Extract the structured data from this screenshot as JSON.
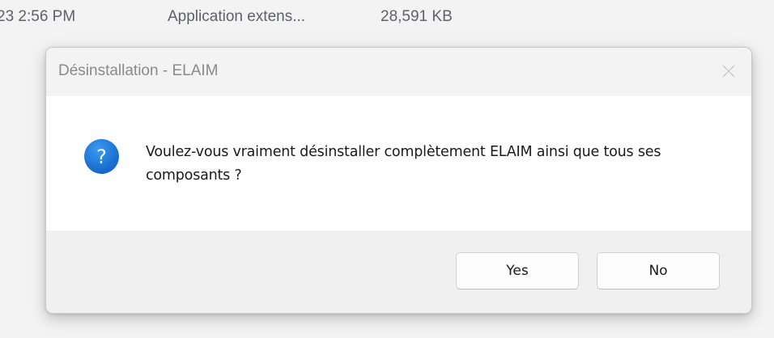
{
  "background_row": {
    "date": "23 2:56 PM",
    "type": "Application extens...",
    "size": "28,591 KB"
  },
  "dialog": {
    "title": "Désinstallation - ELAIM",
    "message": "Voulez-vous vraiment désinstaller complètement ELAIM ainsi que tous ses composants ?",
    "icon": "question-icon",
    "buttons": {
      "yes": "Yes",
      "no": "No"
    },
    "close_icon": "close-icon"
  },
  "colors": {
    "icon_blue": "#1b73d3",
    "titlebar": "#f3f3f3",
    "footer": "#f0f0f0",
    "title_text": "#8a8a8a"
  }
}
